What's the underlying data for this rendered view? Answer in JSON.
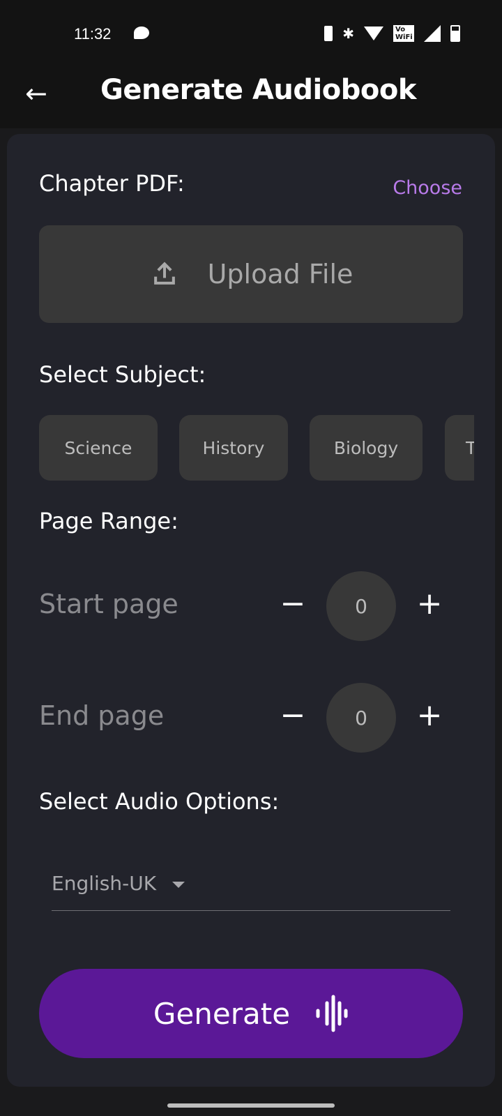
{
  "status_bar": {
    "time": "11:32",
    "icons": [
      "chat-bubble-icon",
      "vibrate-icon",
      "bluetooth-icon",
      "wifi-icon",
      "vowifi-icon",
      "signal-icon",
      "battery-icon"
    ],
    "vowifi": "Vo WiFi"
  },
  "app_bar": {
    "title": "Generate Audiobook",
    "back_icon": "arrow-left-icon"
  },
  "pdf": {
    "label": "Chapter PDF:",
    "choose": "Choose",
    "upload": "Upload File"
  },
  "subject": {
    "label": "Select Subject:",
    "chips": [
      "Science",
      "History",
      "Biology",
      "T"
    ]
  },
  "range": {
    "label": "Page Range:",
    "start_label": "Start page",
    "start_value": "0",
    "end_label": "End page",
    "end_value": "0",
    "minus": "−",
    "plus": "+"
  },
  "audio": {
    "label": "Select Audio Options:",
    "language": "English-UK"
  },
  "generate": {
    "label": "Generate"
  },
  "colors": {
    "accent": "#5b1897",
    "link": "#b97bea",
    "card": "#22232b"
  }
}
